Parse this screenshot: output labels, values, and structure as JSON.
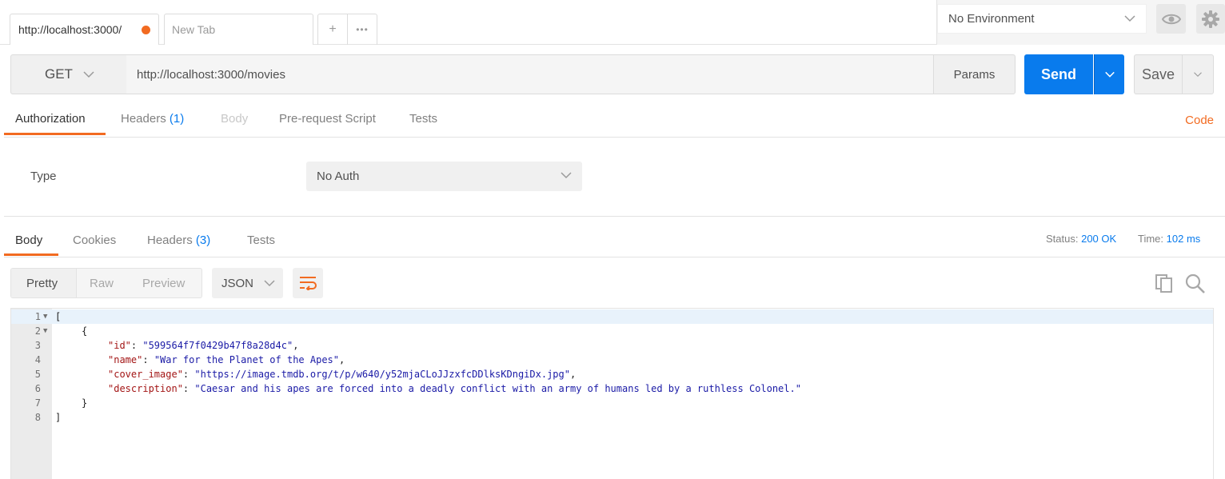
{
  "tabs": {
    "active_url": "http://localhost:3000/",
    "new_tab_label": "New Tab",
    "add_label": "+",
    "more_label": "•••"
  },
  "environment": {
    "selected": "No Environment"
  },
  "request": {
    "method": "GET",
    "url": "http://localhost:3000/movies",
    "params_label": "Params",
    "send_label": "Send",
    "save_label": "Save"
  },
  "request_tabs": {
    "authorization": "Authorization",
    "headers": "Headers",
    "headers_count": "(1)",
    "body": "Body",
    "prerequest": "Pre-request Script",
    "tests": "Tests",
    "code": "Code"
  },
  "auth": {
    "type_label": "Type",
    "selected": "No Auth"
  },
  "response_tabs": {
    "body": "Body",
    "cookies": "Cookies",
    "headers": "Headers",
    "headers_count": "(3)",
    "tests": "Tests",
    "status_label": "Status:",
    "status_value": "200 OK",
    "time_label": "Time:",
    "time_value": "102 ms"
  },
  "response_view": {
    "pretty": "Pretty",
    "raw": "Raw",
    "preview": "Preview",
    "format": "JSON"
  },
  "response_body": {
    "line_numbers": [
      "1",
      "2",
      "3",
      "4",
      "5",
      "6",
      "7",
      "8"
    ],
    "open_bracket": "[",
    "open_brace": "{",
    "close_brace": "}",
    "close_bracket": "]",
    "fields": [
      {
        "key": "\"id\"",
        "value": "\"599564f7f0429b47f8a28d4c\"",
        "trail": ","
      },
      {
        "key": "\"name\"",
        "value": "\"War for the Planet of the Apes\"",
        "trail": ","
      },
      {
        "key": "\"cover_image\"",
        "value": "\"https://image.tmdb.org/t/p/w640/y52mjaCLoJJzxfcDDlksKDngiDx.jpg\"",
        "trail": ","
      },
      {
        "key": "\"description\"",
        "value": "\"Caesar and his apes are forced into a deadly conflict with an army of humans led by a ruthless Colonel.\"",
        "trail": ""
      }
    ]
  },
  "colors": {
    "accent_orange": "#f26b21",
    "send_blue": "#097bed"
  },
  "icons": [
    "unsaved-dot-icon",
    "plus-icon",
    "more-icon",
    "chevron-down-icon",
    "eye-icon",
    "gear-icon",
    "wrap-lines-icon",
    "copy-icon",
    "search-icon",
    "fold-arrow-icon"
  ]
}
